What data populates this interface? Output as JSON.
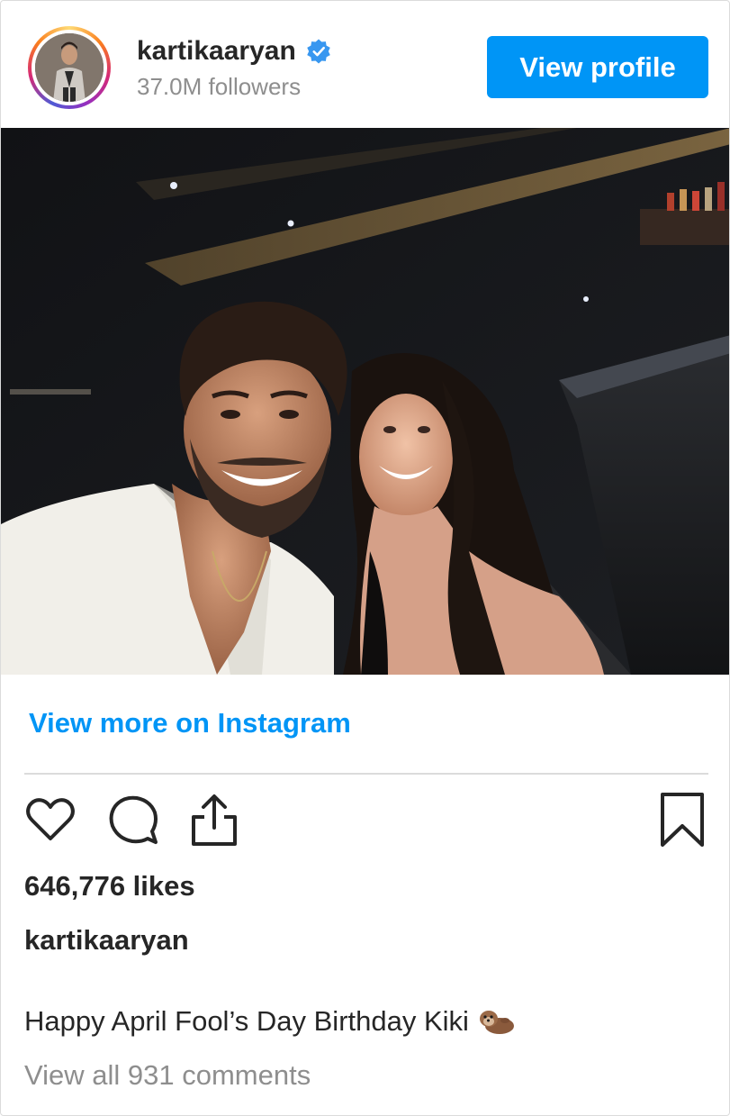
{
  "header": {
    "username": "kartikaaryan",
    "verified": true,
    "followers": "37.0M followers",
    "view_profile_label": "View profile"
  },
  "post": {
    "image_alt": "Selfie of two people smiling in a dimly lit bar"
  },
  "links": {
    "view_more": "View more on Instagram"
  },
  "actions": {
    "icons": [
      "heart-icon",
      "comment-icon",
      "share-icon",
      "bookmark-icon"
    ]
  },
  "stats": {
    "likes": "646,776 likes"
  },
  "caption": {
    "username": "kartikaaryan",
    "text": "Happy April Fool’s Day Birthday Kiki",
    "emoji": "otter-emoji"
  },
  "comments": {
    "view_all": "View all 931 comments"
  },
  "colors": {
    "accent": "#0095f6",
    "text": "#262626",
    "muted": "#8e8e8e",
    "divider": "#dbdbdb"
  }
}
